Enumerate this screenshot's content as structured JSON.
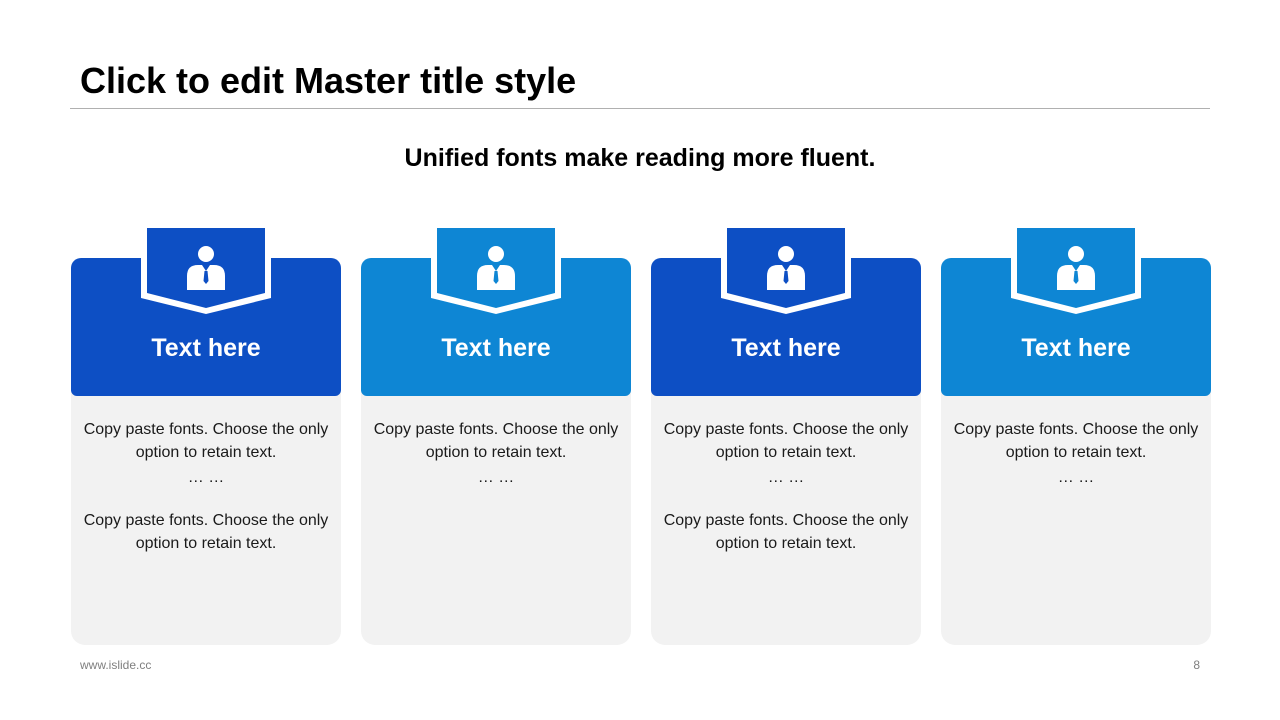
{
  "slide": {
    "title": "Click to edit Master title style",
    "subtitle": "Unified fonts make reading more fluent.",
    "footer_left": "www.islide.cc",
    "page_number": "8"
  },
  "colors": {
    "dark_blue": "#0d4fc4",
    "light_blue": "#0e86d4",
    "card_body": "#f2f2f2"
  },
  "icons": {
    "card_icon": "person-icon"
  },
  "cards": [
    {
      "label": "Text here",
      "line1": "Copy paste fonts. Choose the only option to retain text.",
      "ellipsis": "… …",
      "line2": "Copy paste fonts. Choose the only option to retain text."
    },
    {
      "label": "Text here",
      "line1": "Copy paste fonts. Choose the only option to retain text.",
      "ellipsis": "… …"
    },
    {
      "label": "Text here",
      "line1": "Copy paste fonts. Choose the only option to retain text.",
      "ellipsis": "… …",
      "line2": "Copy paste fonts. Choose the only option to retain text."
    },
    {
      "label": "Text here",
      "line1": "Copy paste fonts. Choose the only option to retain text.",
      "ellipsis": "… …"
    }
  ]
}
